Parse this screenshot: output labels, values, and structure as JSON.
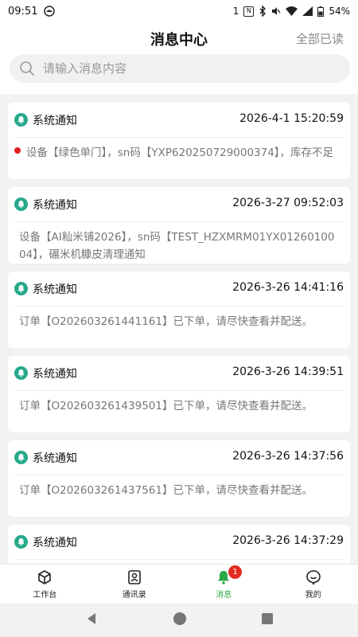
{
  "status_bar": {
    "time": "09:51",
    "notification_count": "1",
    "battery": "54%"
  },
  "header": {
    "title": "消息中心",
    "mark_all_read": "全部已读"
  },
  "search": {
    "placeholder": "请输入消息内容"
  },
  "messages": [
    {
      "type": "系统通知",
      "time": "2026-4-1 15:20:59",
      "content": "设备【绿色单门】，sn码【YXP620250729000374】，库存不足",
      "unread": true
    },
    {
      "type": "系统通知",
      "time": "2026-3-27 09:52:03",
      "content": "设备【AI籼米铺2026】，sn码【TEST_HZXMRM01YX0126010004】，碾米机糠皮清理通知",
      "unread": false
    },
    {
      "type": "系统通知",
      "time": "2026-3-26 14:41:16",
      "content": "订单【O202603261441161】已下单，请尽快查看并配送。",
      "unread": false
    },
    {
      "type": "系统通知",
      "time": "2026-3-26 14:39:51",
      "content": "订单【O202603261439501】已下单，请尽快查看并配送。",
      "unread": false
    },
    {
      "type": "系统通知",
      "time": "2026-3-26 14:37:56",
      "content": "订单【O202603261437561】已下单，请尽快查看并配送。",
      "unread": false
    },
    {
      "type": "系统通知",
      "time": "2026-3-26 14:37:29",
      "content": "",
      "unread": false
    }
  ],
  "tabs": [
    {
      "label": "工作台",
      "icon": "cube-icon",
      "active": false
    },
    {
      "label": "通讯录",
      "icon": "contacts-icon",
      "active": false
    },
    {
      "label": "消息",
      "icon": "bell-icon",
      "active": true,
      "badge": "1"
    },
    {
      "label": "我的",
      "icon": "smile-chat-icon",
      "active": false
    }
  ],
  "colors": {
    "accent": "#2aa845",
    "bell_bg": "#26a98a",
    "unread_dot": "#e0211b",
    "badge": "#e32a20"
  }
}
